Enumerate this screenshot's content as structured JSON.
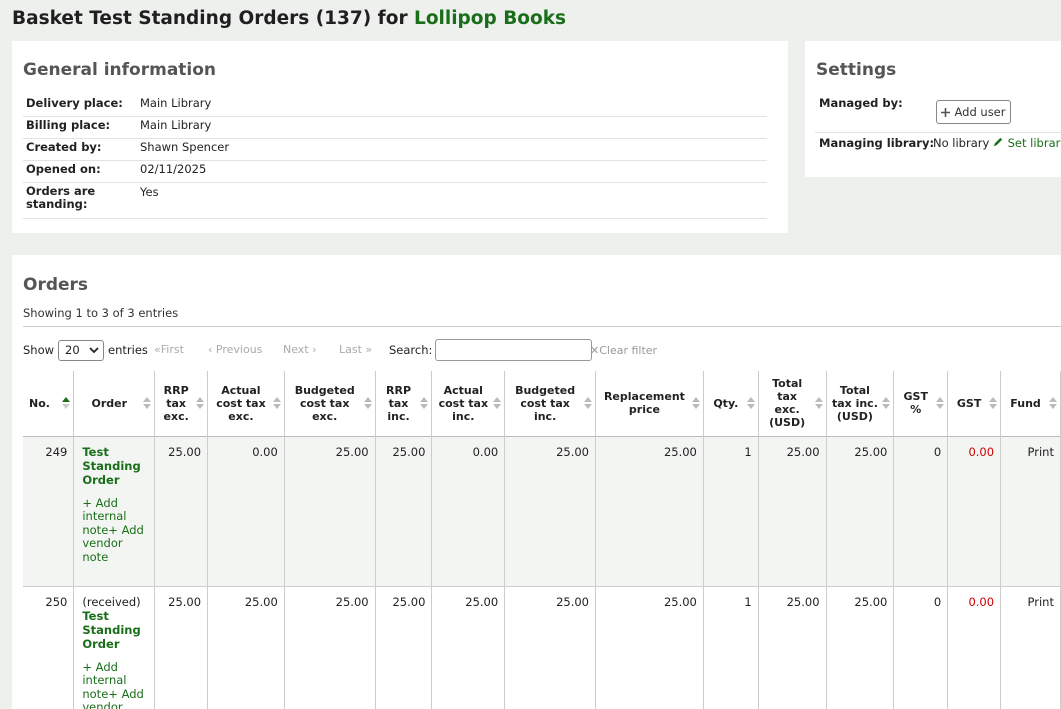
{
  "header": {
    "title_prefix": "Basket Test Standing Orders (137) for",
    "vendor_name": "Lollipop Books"
  },
  "general": {
    "heading": "General information",
    "rows": [
      {
        "label": "Delivery place:",
        "value": "Main Library"
      },
      {
        "label": "Billing place:",
        "value": "Main Library"
      },
      {
        "label": "Created by:",
        "value": "Shawn Spencer"
      },
      {
        "label": "Opened on:",
        "value": "02/11/2025"
      },
      {
        "label": "Orders are standing:",
        "value": "Yes"
      }
    ]
  },
  "settings": {
    "heading": "Settings",
    "managed_by_label": "Managed by:",
    "add_user_label": "Add user",
    "managing_library_label": "Managing library:",
    "no_library_text": "No library",
    "set_library_label": "Set library"
  },
  "orders": {
    "heading": "Orders",
    "showing_text": "Showing 1 to 3 of 3 entries",
    "show_label": "Show",
    "entries_label": "entries",
    "page_length": "20",
    "pager": {
      "first": "First",
      "previous": "Previous",
      "next": "Next",
      "last": "Last"
    },
    "search_label": "Search:",
    "clear_filter": "Clear filter",
    "columns": [
      "No.",
      "Order",
      "RRP tax exc.",
      "Actual cost tax exc.",
      "Budgeted cost tax exc.",
      "RRP tax inc.",
      "Actual cost tax inc.",
      "Budgeted cost tax inc.",
      "Replacement price",
      "Qty.",
      "Total tax exc. (USD)",
      "Total tax inc. (USD)",
      "GST %",
      "GST",
      "Fund"
    ],
    "rows": [
      {
        "no": "249",
        "received": "",
        "title": "Test Standing Order",
        "add_internal_note": "Add internal note",
        "add_vendor_note": "Add vendor note",
        "rrp_exc": "25.00",
        "actual_exc": "0.00",
        "budgeted_exc": "25.00",
        "rrp_inc": "25.00",
        "actual_inc": "0.00",
        "budgeted_inc": "25.00",
        "replacement": "25.00",
        "qty": "1",
        "total_exc": "25.00",
        "total_inc": "25.00",
        "gst_pct": "0",
        "gst": "0.00",
        "fund": "Print"
      },
      {
        "no": "250",
        "received": "(received)",
        "title": "Test Standing Order",
        "add_internal_note": "Add internal note",
        "add_vendor_note": "Add vendor note",
        "rrp_exc": "25.00",
        "actual_exc": "25.00",
        "budgeted_exc": "25.00",
        "rrp_inc": "25.00",
        "actual_inc": "25.00",
        "budgeted_inc": "25.00",
        "replacement": "25.00",
        "qty": "1",
        "total_exc": "25.00",
        "total_inc": "25.00",
        "gst_pct": "0",
        "gst": "0.00",
        "fund": "Print"
      }
    ]
  },
  "colors": {
    "accent_green": "#1a6e1a",
    "negative_red": "#cc0000",
    "page_bg": "#eef0ee"
  }
}
